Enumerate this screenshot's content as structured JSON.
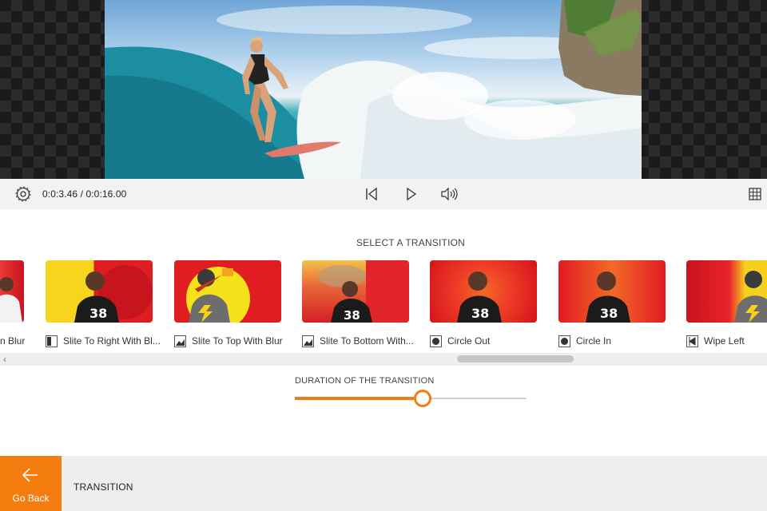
{
  "playback": {
    "time": "0:0:3.46 / 0:0:16.00",
    "icons": [
      "settings-icon",
      "skip-back-icon",
      "play-icon",
      "volume-icon",
      "grid-icon"
    ]
  },
  "transitions": {
    "title": "SELECT A TRANSITION",
    "items": [
      {
        "label": "n Blur",
        "icon": "slide-icon"
      },
      {
        "label": "Slite To Right With Bl...",
        "icon": "slide-right-icon"
      },
      {
        "label": "Slite To Top With Blur",
        "icon": "slide-top-icon"
      },
      {
        "label": "Slite To Bottom With...",
        "icon": "slide-bottom-icon"
      },
      {
        "label": "Circle Out",
        "icon": "circle-out-icon"
      },
      {
        "label": "Circle In",
        "icon": "circle-in-icon"
      },
      {
        "label": "Wipe Left",
        "icon": "wipe-left-icon"
      }
    ]
  },
  "duration": {
    "label": "DURATION OF THE TRANSITION",
    "value_fraction": 0.55
  },
  "bottom": {
    "back_label": "Go Back",
    "title": "TRANSITION"
  },
  "colors": {
    "accent": "#f57d0f",
    "slider": "#f07d1a"
  }
}
